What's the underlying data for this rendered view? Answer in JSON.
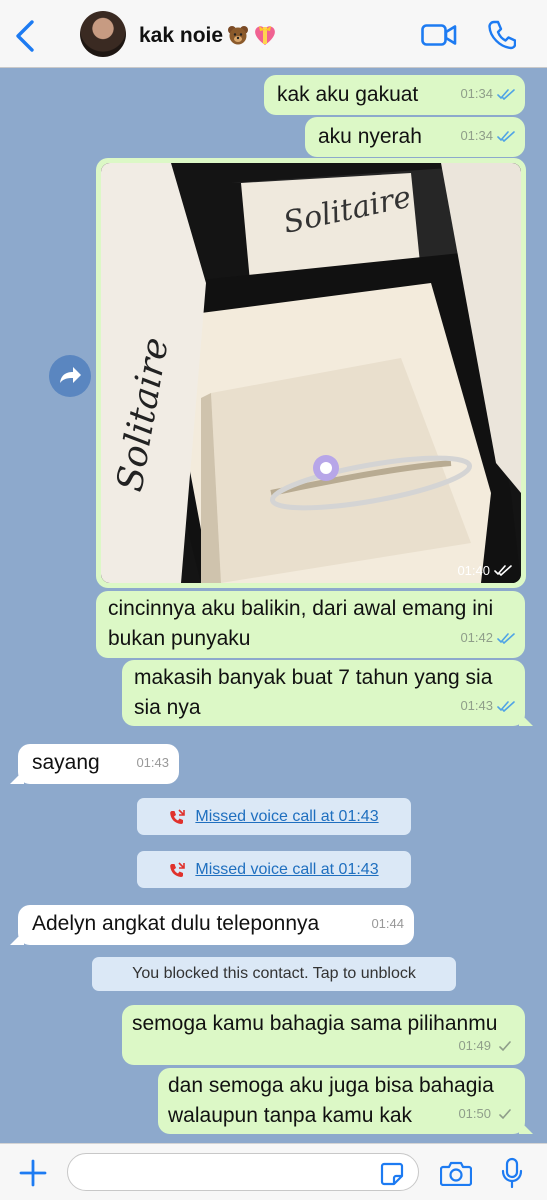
{
  "header": {
    "contact_name": "kak noie",
    "accent": "#1d7bf2"
  },
  "messages": [
    {
      "text": "kak aku gakuat",
      "time": "01:34",
      "dir": "out",
      "status": "read"
    },
    {
      "text": "aku nyerah",
      "time": "01:34",
      "dir": "out",
      "status": "read"
    },
    {
      "type": "photo",
      "time": "01:40",
      "dir": "out",
      "status": "read"
    },
    {
      "text": "cincinnya aku balikin, dari awal emang ini bukan punyaku",
      "time": "01:42",
      "dir": "out",
      "status": "read"
    },
    {
      "text": "makasih banyak buat 7 tahun yang sia sia nya",
      "time": "01:43",
      "dir": "out",
      "status": "read"
    },
    {
      "text": "sayang",
      "time": "01:43",
      "dir": "in"
    },
    {
      "text": "Adelyn angkat dulu teleponnya",
      "time": "01:44",
      "dir": "in"
    },
    {
      "text": "semoga kamu bahagia sama pilihanmu",
      "time": "01:49",
      "dir": "out",
      "status": "delivered"
    },
    {
      "text": "dan semoga aku juga bisa bahagia walaupun tanpa kamu kak",
      "time": "01:50",
      "dir": "out",
      "status": "delivered"
    }
  ],
  "system": {
    "missed_call_1": "Missed voice call at 01:43",
    "missed_call_2": "Missed voice call at 01:43",
    "blocked": "You blocked this contact. Tap to unblock"
  },
  "colors": {
    "outgoing_bubble": "#dcf8c6",
    "incoming_bubble": "#ffffff",
    "read_tick": "#4fa3e6",
    "missed_call": "#e0312c"
  },
  "input": {
    "value": ""
  }
}
